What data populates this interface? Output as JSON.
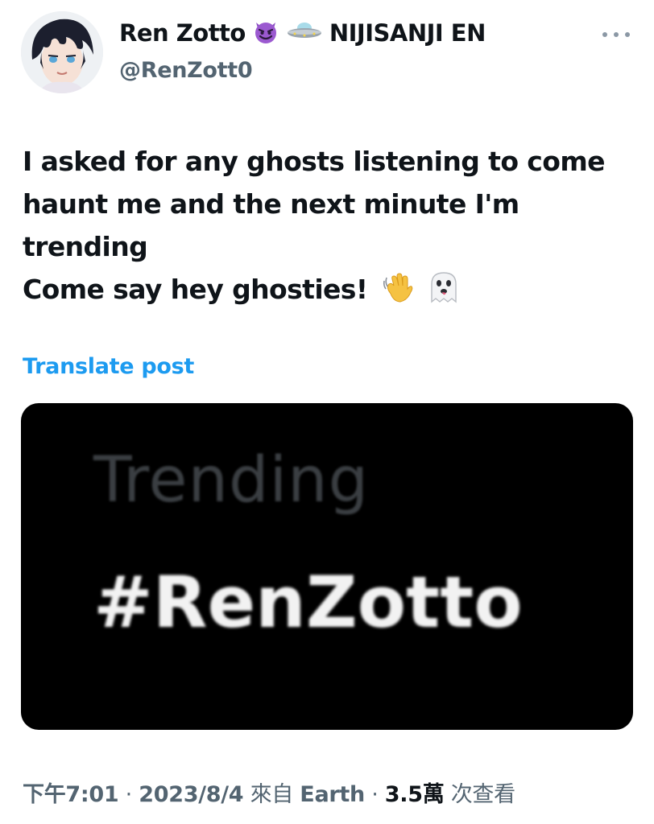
{
  "author": {
    "display_name": "Ren Zotto",
    "affiliation": "NIJISANJI EN",
    "handle": "@RenZott0",
    "badges": [
      "smiling-devil-emoji",
      "flying-saucer-emoji"
    ]
  },
  "tweet": {
    "lines": [
      "I asked for any ghosts listening to come",
      "haunt me and the next minute I'm",
      "trending",
      "Come say hey ghosties!"
    ],
    "trailing_emoji": [
      "waving-hand-emoji",
      "ghost-emoji"
    ]
  },
  "translate": {
    "label": "Translate post"
  },
  "media": {
    "heading": "Trending",
    "hashtag": "#RenZotto"
  },
  "meta": {
    "time": "下午7:01",
    "separator": "·",
    "date": "2023/8/4",
    "source_prefix": "來自",
    "source": "Earth",
    "views_count": "3.5萬",
    "views_label": "次查看"
  },
  "colors": {
    "link": "#1d9bf0",
    "muted": "#536471",
    "text": "#0f1419"
  }
}
